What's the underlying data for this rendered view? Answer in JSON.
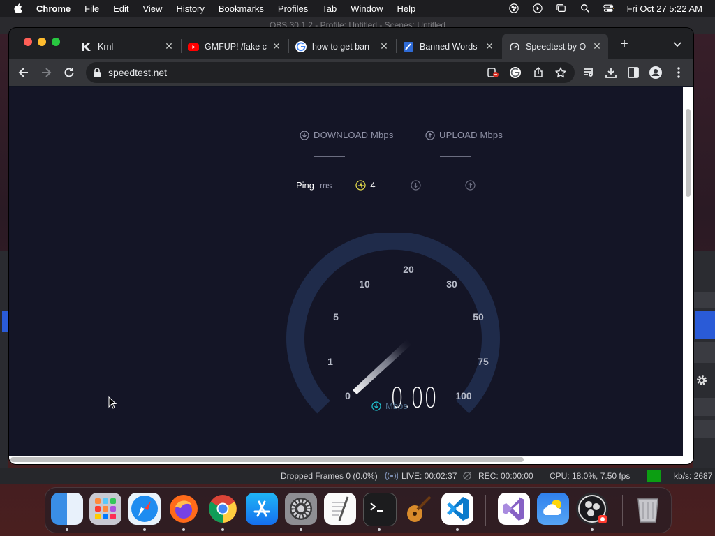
{
  "menubar": {
    "app_name": "Chrome",
    "menus": [
      "File",
      "Edit",
      "View",
      "History",
      "Bookmarks",
      "Profiles",
      "Tab",
      "Window",
      "Help"
    ],
    "clock": "Fri Oct 27  5:22 AM"
  },
  "obs": {
    "title": "OBS 30.1.2 - Profile: Untitled - Scenes: Untitled",
    "status": {
      "dropped_frames": "Dropped Frames 0 (0.0%)",
      "live": "LIVE: 00:02:37",
      "rec": "REC: 00:00:00",
      "cpu": "CPU: 18.0%, 7.50 fps",
      "kbs": "kb/s: 2687"
    }
  },
  "chrome": {
    "tabs": [
      {
        "title": "Krnl",
        "icon": "krnl-favicon"
      },
      {
        "title": "GMFUP! /fake c",
        "icon": "youtube-favicon"
      },
      {
        "title": "how to get ban",
        "icon": "google-favicon"
      },
      {
        "title": "Banned Words",
        "icon": "banned-words-favicon"
      },
      {
        "title": "Speedtest by O",
        "icon": "speedtest-favicon",
        "active": true
      }
    ],
    "url": "speedtest.net"
  },
  "speedtest": {
    "download_label": "DOWNLOAD Mbps",
    "upload_label": "UPLOAD Mbps",
    "ping_label": "Ping",
    "ping_unit": "ms",
    "ping_value": "4",
    "download_ping": "—",
    "upload_ping": "—",
    "gauge_labels": [
      "0",
      "1",
      "5",
      "10",
      "20",
      "30",
      "50",
      "75",
      "100"
    ],
    "speed_value": "0.00",
    "speed_unit": "Mbps"
  },
  "dock": {
    "apps": [
      "Finder",
      "Launchpad",
      "Safari",
      "Firefox",
      "Chrome",
      "App Store",
      "System Settings",
      "TextEdit",
      "Terminal",
      "GarageBand",
      "Visual Studio Code",
      "Visual Studio",
      "Weather",
      "OBS",
      "Trash"
    ]
  },
  "colors": {
    "page_bg": "#141526",
    "gauge_track": "#1f2b4a",
    "accent_cyan": "#1fc7d4",
    "ping_yellow": "#e0d84a"
  }
}
